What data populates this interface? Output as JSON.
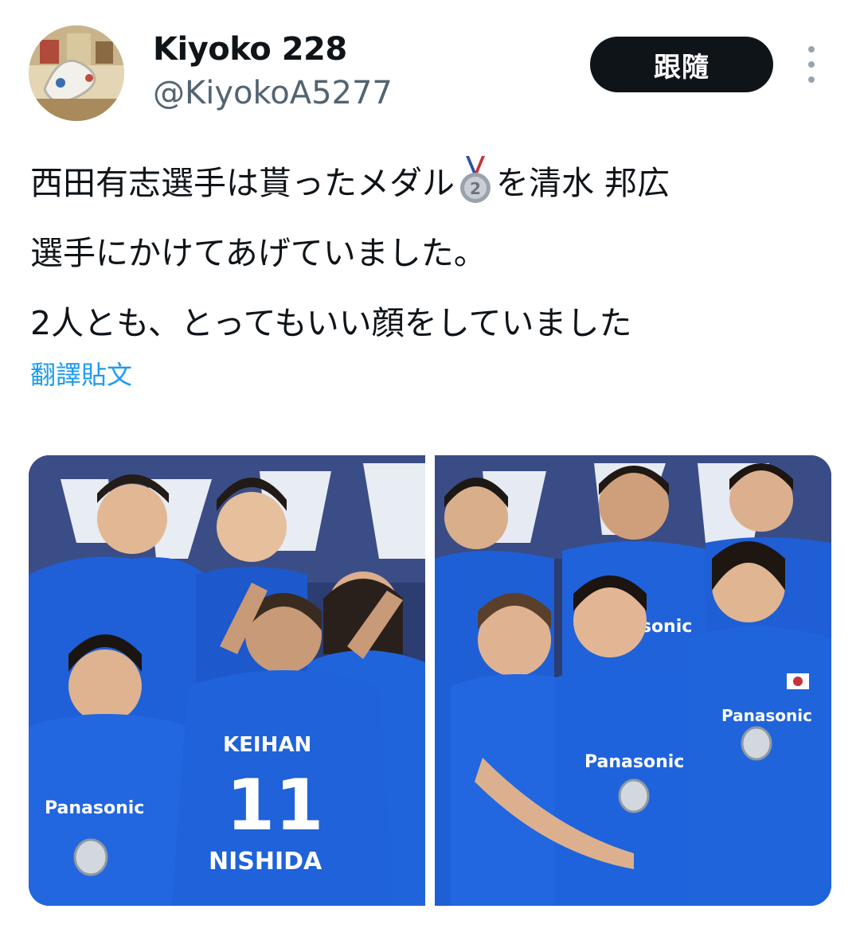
{
  "author": {
    "display_name": "Kiyoko 228",
    "handle": "@KiyokoA5277"
  },
  "follow_button": {
    "label": "跟隨"
  },
  "more_menu": {
    "icon": "more-vertical-icon"
  },
  "tweet": {
    "line1_a": "西田有志選手は貰ったメダル",
    "medal_emoji": "silver-medal-2-icon",
    "line1_b": "を清水 邦広",
    "line2": "選手にかけてあげていました。",
    "line3": "2人とも、とってもいい顔をしていました"
  },
  "translate_link": "翻譯貼文",
  "media": {
    "photo_count": 2,
    "left_photo": {
      "jersey_sponsor": "KEIHAN",
      "jersey_number": "11",
      "jersey_name": "NISHIDA",
      "shirt_brand": "Panasonic"
    },
    "right_photo": {
      "shirt_brand": "Panasonic"
    }
  },
  "colors": {
    "accent_link": "#1d9bf0",
    "follow_bg": "#0f1419",
    "handle_gray": "#536471",
    "jersey_blue": "#1f5fd8"
  }
}
